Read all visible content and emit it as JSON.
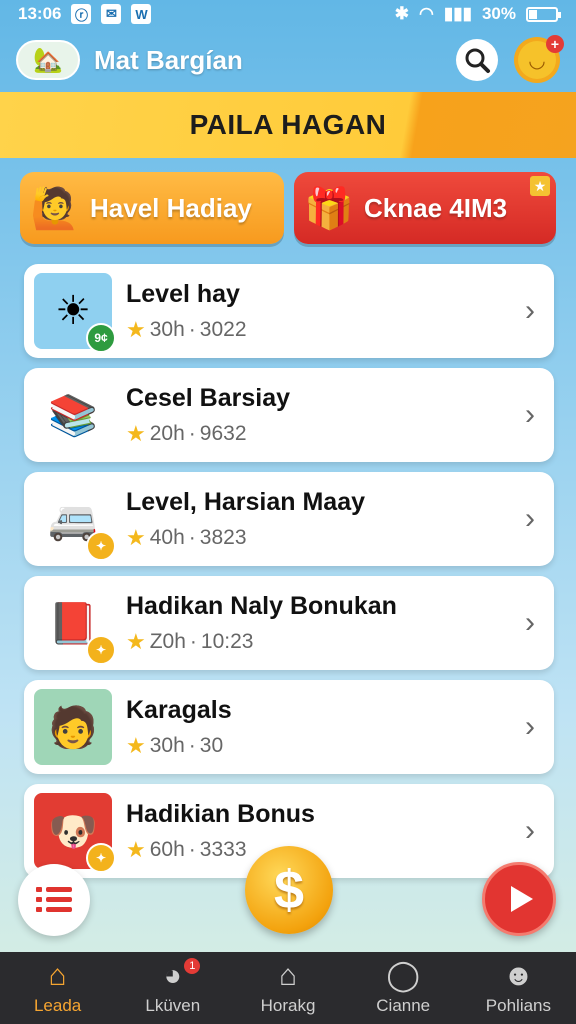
{
  "status_bar": {
    "time": "13:06",
    "app_icons": [
      "ⓡ",
      "✉",
      "W"
    ],
    "battery": "30%",
    "battery_level": 0.3
  },
  "header": {
    "app_name": "Mat Bargían"
  },
  "banner": {
    "title": "PAILA HAGAN"
  },
  "promos": [
    {
      "label": "Havel Hadiay",
      "art": "🙋"
    },
    {
      "label": "Cknae 4IM3",
      "art": "🎁"
    }
  ],
  "items": [
    {
      "title": "Level hay",
      "duration": "30h",
      "count": "3022",
      "art": "☀",
      "badge": "9¢",
      "thumb_color": "#8fd0f0",
      "badge_color": "#2e9b3f"
    },
    {
      "title": "Cesel Barsiay",
      "duration": "20h",
      "count": "9632",
      "art": "📚",
      "badge": "",
      "thumb_color": "#ffffff",
      "badge_color": "#e14a4a"
    },
    {
      "title": "Level, Harsian Maay",
      "duration": "40h",
      "count": "3823",
      "art": "🚐",
      "badge": "✦",
      "thumb_color": "#ffffff",
      "badge_color": "#f3b21c"
    },
    {
      "title": "Hadikan Naly Bonukan",
      "duration": "Z0h",
      "count": "10:23",
      "art": "📕",
      "badge": "✦",
      "thumb_color": "#ffffff",
      "badge_color": "#f3b21c"
    },
    {
      "title": "Karagals",
      "duration": "30h",
      "count": "30",
      "art": "🧑",
      "badge": "",
      "thumb_color": "#9fd6b7",
      "badge_color": "#2e9b3f"
    },
    {
      "title": "Hadikian Bonus",
      "duration": "60h",
      "count": "3333",
      "art": "🐶",
      "badge": "✦",
      "thumb_color": "#e23c33",
      "badge_color": "#f3b21c"
    }
  ],
  "fabs": {
    "coin_symbol": "$"
  },
  "bottom_nav": [
    {
      "label": "Leada",
      "icon": "home-icon",
      "active": true
    },
    {
      "label": "Lküven",
      "icon": "profile-icon",
      "active": false,
      "badge": "1"
    },
    {
      "label": "Horakg",
      "icon": "house-outline-icon",
      "active": false
    },
    {
      "label": "Cianne",
      "icon": "search-ring-icon",
      "active": false
    },
    {
      "label": "Pohlians",
      "icon": "person-icon",
      "active": false
    }
  ],
  "colors": {
    "accent": "#f6a531",
    "banner": "#ffcb3a",
    "danger": "#e23531"
  }
}
